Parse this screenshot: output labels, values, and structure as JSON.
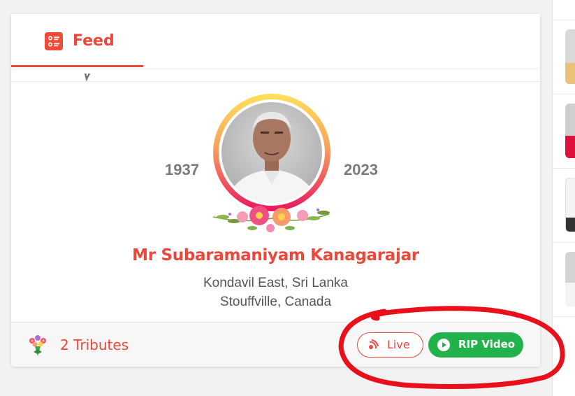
{
  "feed_tab": {
    "label": "Feed"
  },
  "memorial": {
    "birth_year": "1937",
    "death_year": "2023",
    "name": "Mr Subaramaniyam Kanagarajar",
    "birth_place": "Kondavil East, Sri Lanka",
    "residence": "Stouffville, Canada"
  },
  "footer": {
    "tributes_label": "2 Tributes",
    "live_label": "Live",
    "rip_video_label": "RIP Video"
  },
  "colors": {
    "accent": "#e9483a",
    "rip_video_button": "#21b24c",
    "annotation": "#e8101a"
  },
  "icons": {
    "tab": "feed-list-icon",
    "tributes": "flower-bouquet-icon",
    "live": "live-broadcast-icon",
    "rip_video": "play-circle-icon"
  }
}
